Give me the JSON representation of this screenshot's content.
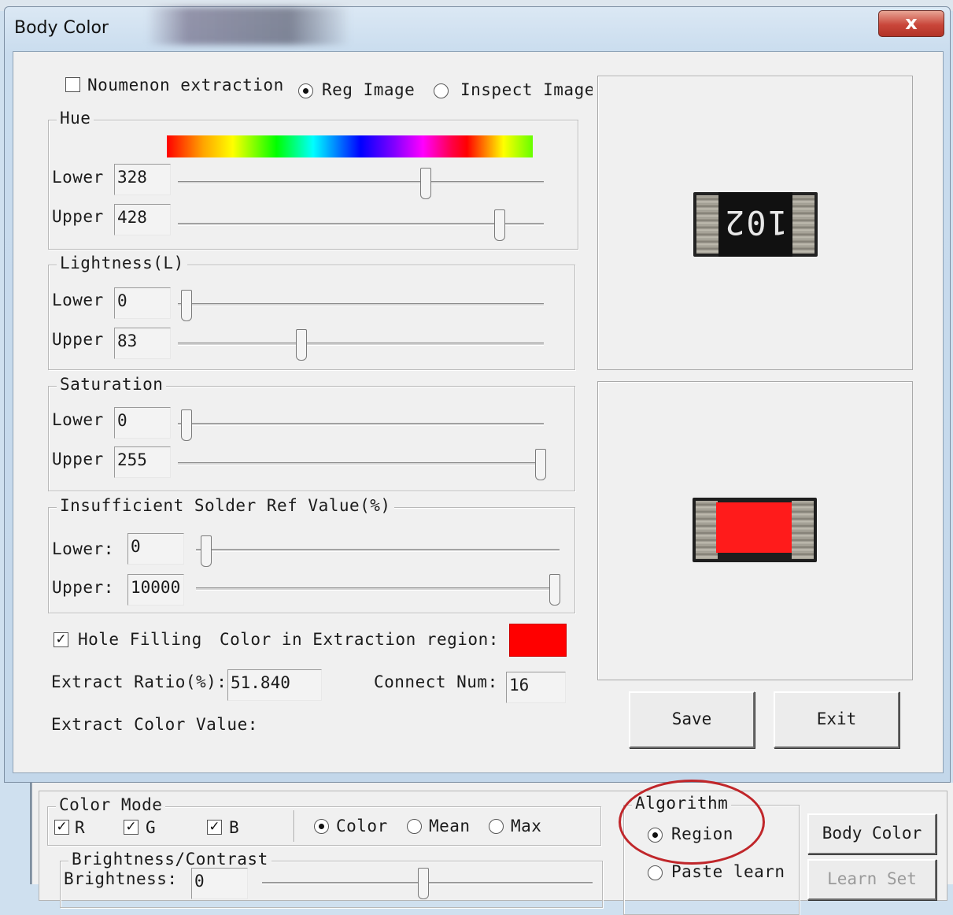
{
  "window": {
    "title": "Body Color",
    "close_label": "x"
  },
  "options": {
    "noumenon_label": "Noumenon extraction",
    "noumenon_checked": false,
    "reg_image_label": "Reg Image",
    "reg_image_selected": true,
    "inspect_image_label": "Inspect Image",
    "inspect_image_selected": false
  },
  "hue": {
    "label": "Hue",
    "lower_label": "Lower",
    "lower_value": "328",
    "upper_label": "Upper",
    "upper_value": "428"
  },
  "lightness": {
    "label": "Lightness(L)",
    "lower_label": "Lower",
    "lower_value": "0",
    "upper_label": "Upper",
    "upper_value": "83"
  },
  "saturation": {
    "label": "Saturation",
    "lower_label": "Lower",
    "lower_value": "0",
    "upper_label": "Upper",
    "upper_value": "255"
  },
  "solder": {
    "label": "Insufficient Solder Ref Value(%)",
    "lower_label": "Lower:",
    "lower_value": "0",
    "upper_label": "Upper:",
    "upper_value": "10000"
  },
  "hole_filling": {
    "label": "Hole Filling",
    "checked": true
  },
  "color_region_label": "Color in Extraction region:",
  "color_region_swatch": "#ff0000",
  "extract_ratio": {
    "label": "Extract Ratio(%):",
    "value": "51.840"
  },
  "connect_num": {
    "label": "Connect Num:",
    "value": "16"
  },
  "extract_color_value_label": "Extract Color Value:",
  "preview": {
    "reg_marking": "102"
  },
  "buttons": {
    "save": "Save",
    "exit": "Exit"
  },
  "color_mode": {
    "label": "Color Mode",
    "r_label": "R",
    "g_label": "G",
    "b_label": "B",
    "color_label": "Color",
    "mean_label": "Mean",
    "max_label": "Max",
    "selected": "Color"
  },
  "brightness_contrast": {
    "label": "Brightness/Contrast",
    "brightness_label": "Brightness:",
    "brightness_value": "0"
  },
  "algorithm": {
    "label": "Algorithm",
    "region_label": "Region",
    "paste_learn_label": "Paste learn",
    "selected": "Region"
  },
  "lower_buttons": {
    "body_color": "Body Color",
    "learn_set": "Learn Set"
  },
  "annotation_color": "#c0262a"
}
